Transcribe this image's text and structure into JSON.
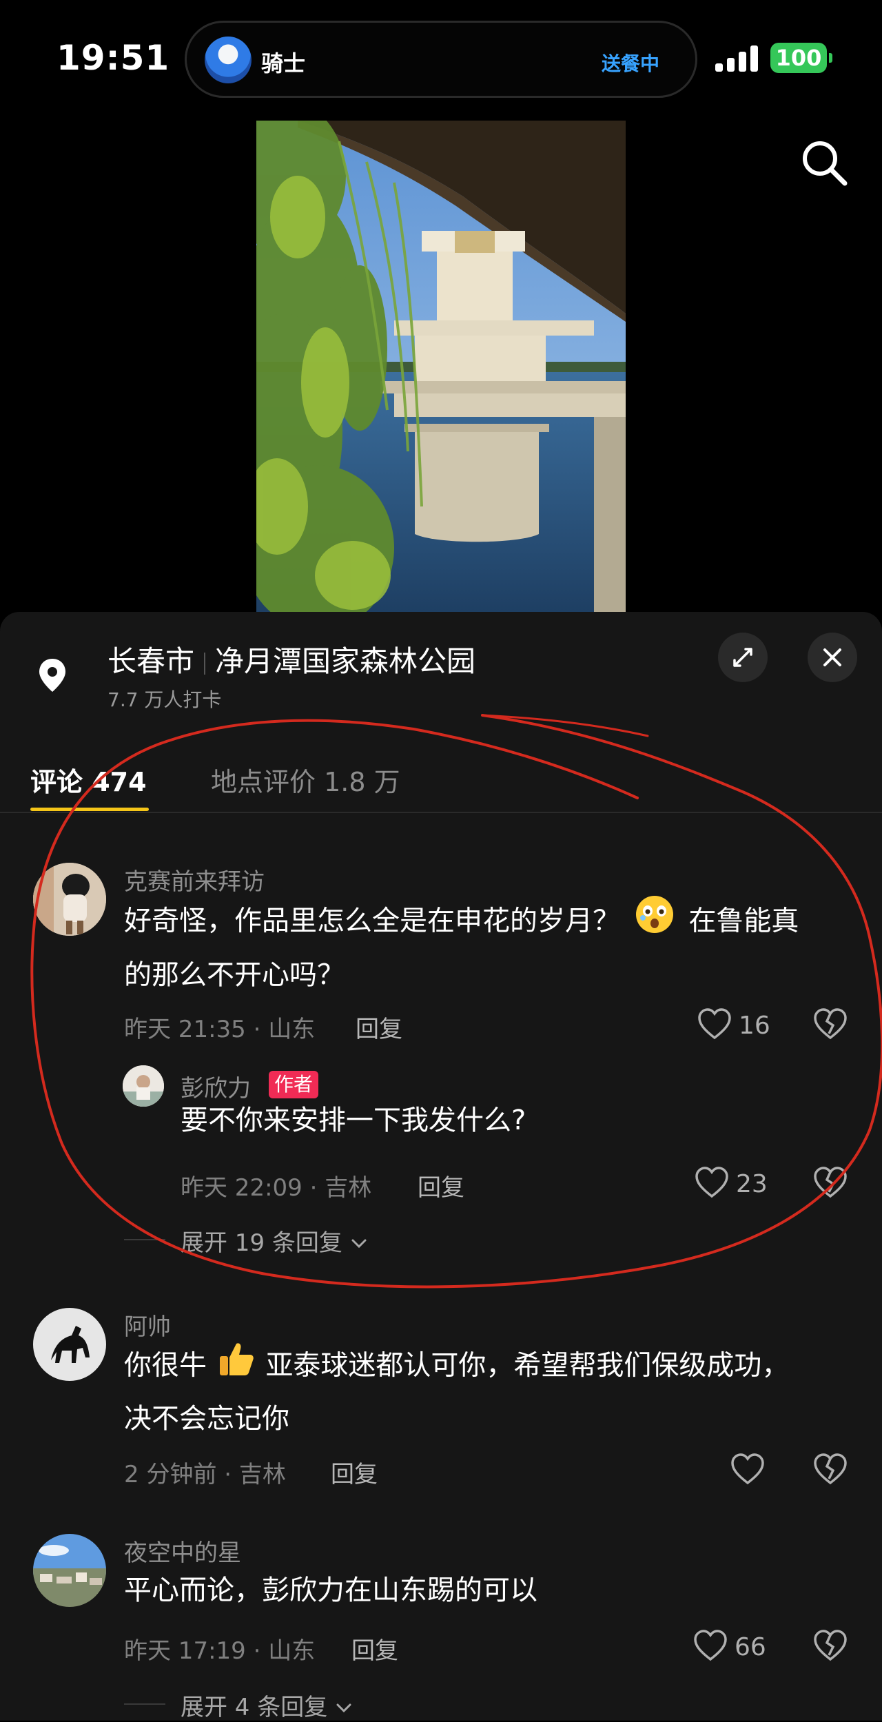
{
  "status_bar": {
    "time": "19:51",
    "live_activity": {
      "label": "骑士",
      "status": "送餐中",
      "status_color": "#38a3ff"
    },
    "battery": "100",
    "battery_color": "#35c759"
  },
  "location": {
    "city": "长春市",
    "place": "净月潭国家森林公园",
    "checkins": "7.7 万人打卡"
  },
  "tabs": [
    {
      "label": "评论 474",
      "active": true
    },
    {
      "label": "地点评价 1.8 万",
      "active": false
    }
  ],
  "accent_color": "#f5c518",
  "comments": [
    {
      "user": "克赛前来拜访",
      "text_line1": "好奇怪，作品里怎么全是在申花的岁月？",
      "text_line1b": "在鲁能真",
      "text_line2": "的那么不开心吗？",
      "emoji": "face-with-open-mouth-emoji",
      "meta": "昨天 21:35 · 山东",
      "reply_label": "回复",
      "likes": "16",
      "reply": {
        "user": "彭欣力",
        "badge": "作者",
        "text": "要不你来安排一下我发什么?",
        "meta": "昨天 22:09 · 吉林",
        "reply_label": "回复",
        "likes": "23"
      },
      "expand": "展开 19 条回复"
    },
    {
      "user": "阿帅",
      "text_line1a": "你很牛",
      "text_line1b": "亚泰球迷都认可你，希望帮我们保级成功，",
      "text_line2": "决不会忘记你",
      "emoji": "thumbs-up-emoji",
      "meta": "2 分钟前 · 吉林",
      "reply_label": "回复",
      "likes": ""
    },
    {
      "user": "夜空中的星",
      "text_line1": "平心而论，彭欣力在山东踢的可以",
      "meta": "昨天 17:19 · 山东",
      "reply_label": "回复",
      "likes": "66",
      "expand": "展开 4 条回复"
    }
  ],
  "icons": [
    "search-icon",
    "location-pin-icon",
    "expand-icon",
    "close-icon",
    "heart-icon",
    "broken-heart-icon",
    "chevron-down-icon"
  ],
  "annotation_color": "#d42a1e"
}
